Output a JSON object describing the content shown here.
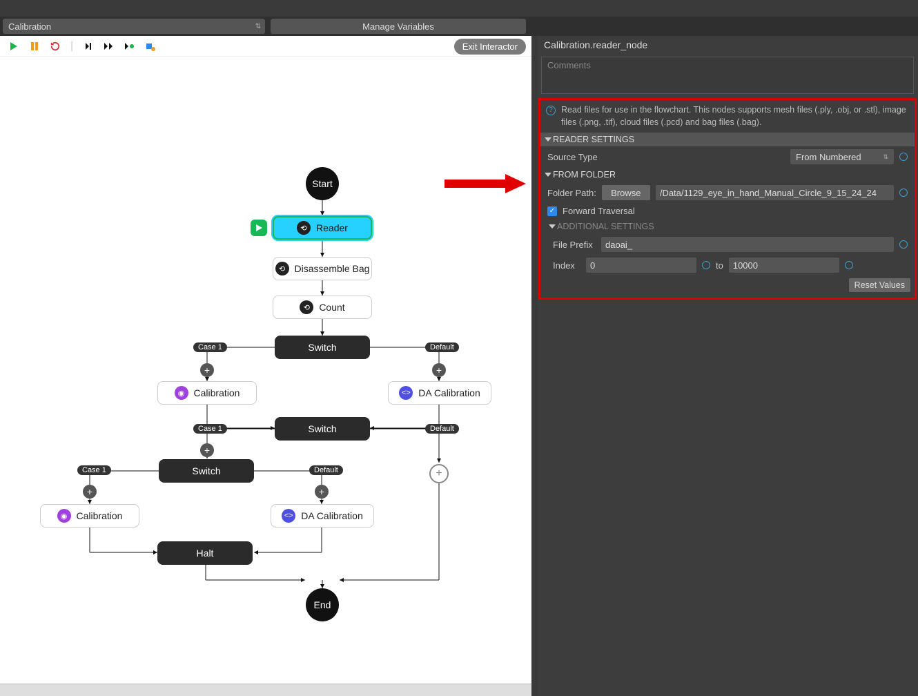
{
  "toolbar": {
    "flowchart_selected": "Calibration",
    "manage_variables": "Manage Variables",
    "exit_interactor": "Exit Interactor"
  },
  "flow": {
    "start": "Start",
    "reader": "Reader",
    "disassemble": "Disassemble Bag",
    "count": "Count",
    "switch": "Switch",
    "calibration": "Calibration",
    "da_calibration": "DA Calibration",
    "halt": "Halt",
    "end": "End",
    "case1": "Case 1",
    "default": "Default"
  },
  "inspector": {
    "title": "Calibration.reader_node",
    "comments_placeholder": "Comments",
    "info_text": "Read files for use in the flowchart. This nodes supports mesh files (.ply, .obj, or .stl), image files (.png, .tif), cloud files (.pcd) and bag files (.bag).",
    "sections": {
      "reader": "READER SETTINGS",
      "from_folder": "FROM FOLDER",
      "additional": "ADDITIONAL SETTINGS"
    },
    "source_type_label": "Source Type",
    "source_type_value": "From Numbered",
    "folder_path_label": "Folder Path:",
    "browse": "Browse",
    "folder_path_value": "/Data/1129_eye_in_hand_Manual_Circle_9_15_24_24",
    "forward_traversal": "Forward Traversal",
    "file_prefix_label": "File Prefix",
    "file_prefix_value": "daoai_",
    "index_label": "Index",
    "index_from": "0",
    "index_to_label": "to",
    "index_to": "10000",
    "reset": "Reset Values"
  }
}
